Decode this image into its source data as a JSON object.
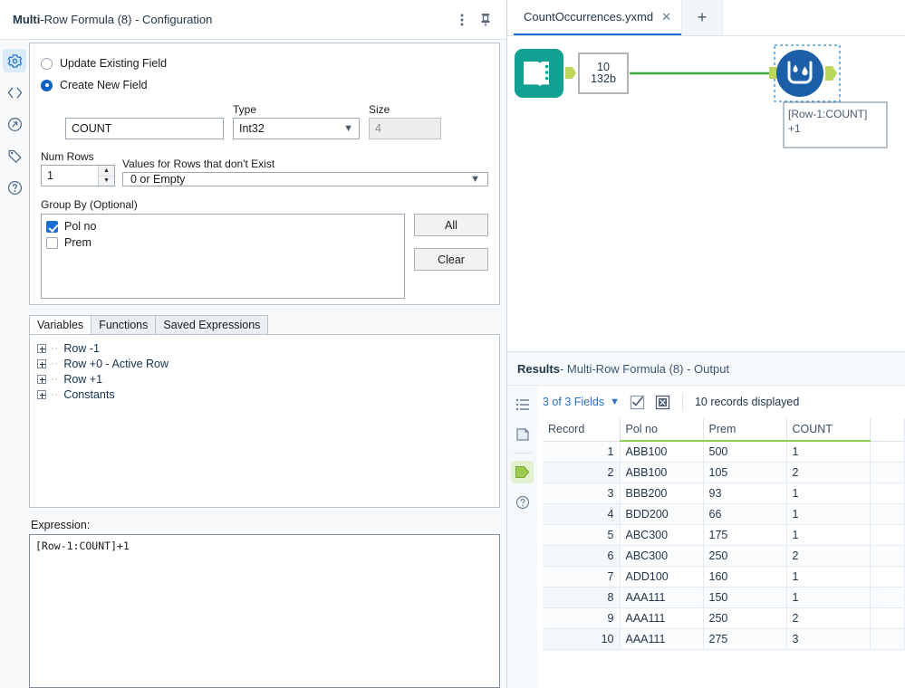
{
  "config_panel": {
    "title_bold": "Multi",
    "title_rest": "-Row Formula (8) - Configuration",
    "more_icon": "kebab-menu-icon",
    "pin_icon": "pin-icon",
    "rail": [
      {
        "name": "configuration",
        "icon": "gear-icon",
        "active": true
      },
      {
        "name": "xml-view",
        "icon": "code-brackets-icon",
        "active": false
      },
      {
        "name": "annotation",
        "icon": "arrow-in-circle-icon",
        "active": false
      },
      {
        "name": "labels",
        "icon": "tag-icon",
        "active": false
      },
      {
        "name": "help",
        "icon": "question-circle-icon",
        "active": false
      }
    ],
    "update_existing_field": "Update Existing Field",
    "create_new_field": "Create New  Field",
    "field_name_value": "COUNT",
    "type_label": "Type",
    "type_value": "Int32",
    "size_label": "Size",
    "size_value": "4",
    "num_rows_label": "Num Rows",
    "num_rows_value": "1",
    "values_for_rows_label": "Values for Rows that don't Exist",
    "values_for_rows_value": "0 or Empty",
    "group_by_label": "Group By (Optional)",
    "group_by_items": [
      {
        "label": "Pol no",
        "checked": true
      },
      {
        "label": "Prem",
        "checked": false
      }
    ],
    "all_button": "All",
    "clear_button": "Clear",
    "tabs": [
      {
        "label": "Variables",
        "active": true
      },
      {
        "label": "Functions",
        "active": false
      },
      {
        "label": "Saved Expressions",
        "active": false
      }
    ],
    "tree_items": [
      "Row -1",
      "Row +0 - Active Row",
      "Row +1",
      "Constants"
    ],
    "expression_label": "Expression:",
    "expression_value": "[Row-1:COUNT]+1"
  },
  "document_tabs": {
    "tab_label": "CountOccurrences.yxmd",
    "close_icon": "close-icon",
    "new_tab_icon": "plus-icon"
  },
  "canvas": {
    "input_node": {
      "name": "text-input-node",
      "icon": "open-book-icon",
      "color": "#12a092"
    },
    "connection_label_top": "10",
    "connection_label_bottom": "132b",
    "connection_color": "#3faa3f",
    "formula_node": {
      "name": "multi-row-formula-node",
      "icon": "water-container-icon",
      "color": "#1b5fa8"
    },
    "annotation_line1": "[Row-1:COUNT]",
    "annotation_line2": "+1",
    "selection_color": "#2a8fd8"
  },
  "results": {
    "title_bold": "Results",
    "title_rest": " - Multi-Row Formula (8) - Output",
    "rail": [
      {
        "name": "messages",
        "icon": "list-icon"
      },
      {
        "name": "metadata",
        "icon": "page-icon"
      },
      {
        "name": "output-anchor",
        "icon": "output-anchor-icon",
        "highlighted": true
      },
      {
        "name": "help",
        "icon": "question-circle-icon"
      }
    ],
    "fields_selector": "3 of 3 Fields",
    "chevron_icon": "chevron-down-icon",
    "select_all_icon": "checkbox-checked-icon",
    "deselect_all_icon": "boxed-x-icon",
    "record_count": "10 records displayed",
    "columns": [
      "Record",
      "Pol no",
      "Prem",
      "COUNT"
    ],
    "rows": [
      [
        "1",
        "ABB100",
        "500",
        "1"
      ],
      [
        "2",
        "ABB100",
        "105",
        "2"
      ],
      [
        "3",
        "BBB200",
        "93",
        "1"
      ],
      [
        "4",
        "BDD200",
        "66",
        "1"
      ],
      [
        "5",
        "ABC300",
        "175",
        "1"
      ],
      [
        "6",
        "ABC300",
        "250",
        "2"
      ],
      [
        "7",
        "ADD100",
        "160",
        "1"
      ],
      [
        "8",
        "AAA111",
        "150",
        "1"
      ],
      [
        "9",
        "AAA111",
        "250",
        "2"
      ],
      [
        "10",
        "AAA111",
        "275",
        "3"
      ]
    ]
  }
}
